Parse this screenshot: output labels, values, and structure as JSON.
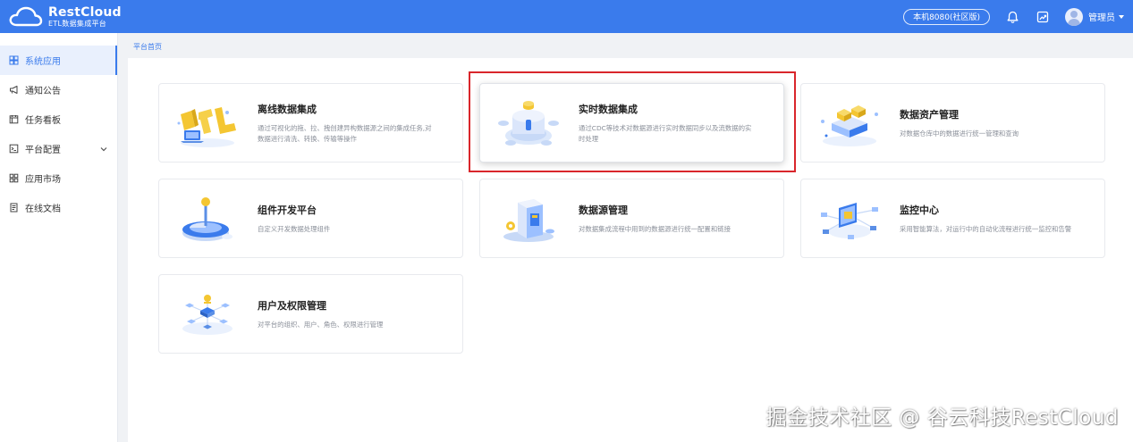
{
  "header": {
    "logo_name": "RestCloud",
    "logo_sub": "ETL数据集成平台",
    "env_label": "本机8080(社区版)",
    "user_name": "管理员",
    "accent": "#3a7bec"
  },
  "sidebar": {
    "items": [
      {
        "label": "系统应用",
        "icon": "grid-icon",
        "active": true
      },
      {
        "label": "通知公告",
        "icon": "megaphone-icon"
      },
      {
        "label": "任务看板",
        "icon": "calendar-icon"
      },
      {
        "label": "平台配置",
        "icon": "terminal-icon",
        "expandable": true
      },
      {
        "label": "应用市场",
        "icon": "apps-icon"
      },
      {
        "label": "在线文档",
        "icon": "document-icon"
      }
    ]
  },
  "breadcrumb": "平台首页",
  "cards": [
    {
      "title": "离线数据集成",
      "desc": "通过可视化的拖、拉、拽创建异构数据源之间的集成任务,对数据进行清洗、转换、传输等操作"
    },
    {
      "title": "实时数据集成",
      "desc": "通过CDC等技术对数据源进行实时数据同步以及流数据的实时处理"
    },
    {
      "title": "数据资产管理",
      "desc": "对数据仓库中的数据进行统一管理和查询"
    },
    {
      "title": "组件开发平台",
      "desc": "自定义开发数据处理组件"
    },
    {
      "title": "数据源管理",
      "desc": "对数据集成流程中用到的数据源进行统一配置和链接"
    },
    {
      "title": "监控中心",
      "desc": "采用智能算法，对运行中的自动化流程进行统一监控和告警"
    },
    {
      "title": "用户及权限管理",
      "desc": "对平台的组织、用户、角色、权限进行管理"
    }
  ],
  "watermark": "掘金技术社区 @ 谷云科技RestCloud"
}
